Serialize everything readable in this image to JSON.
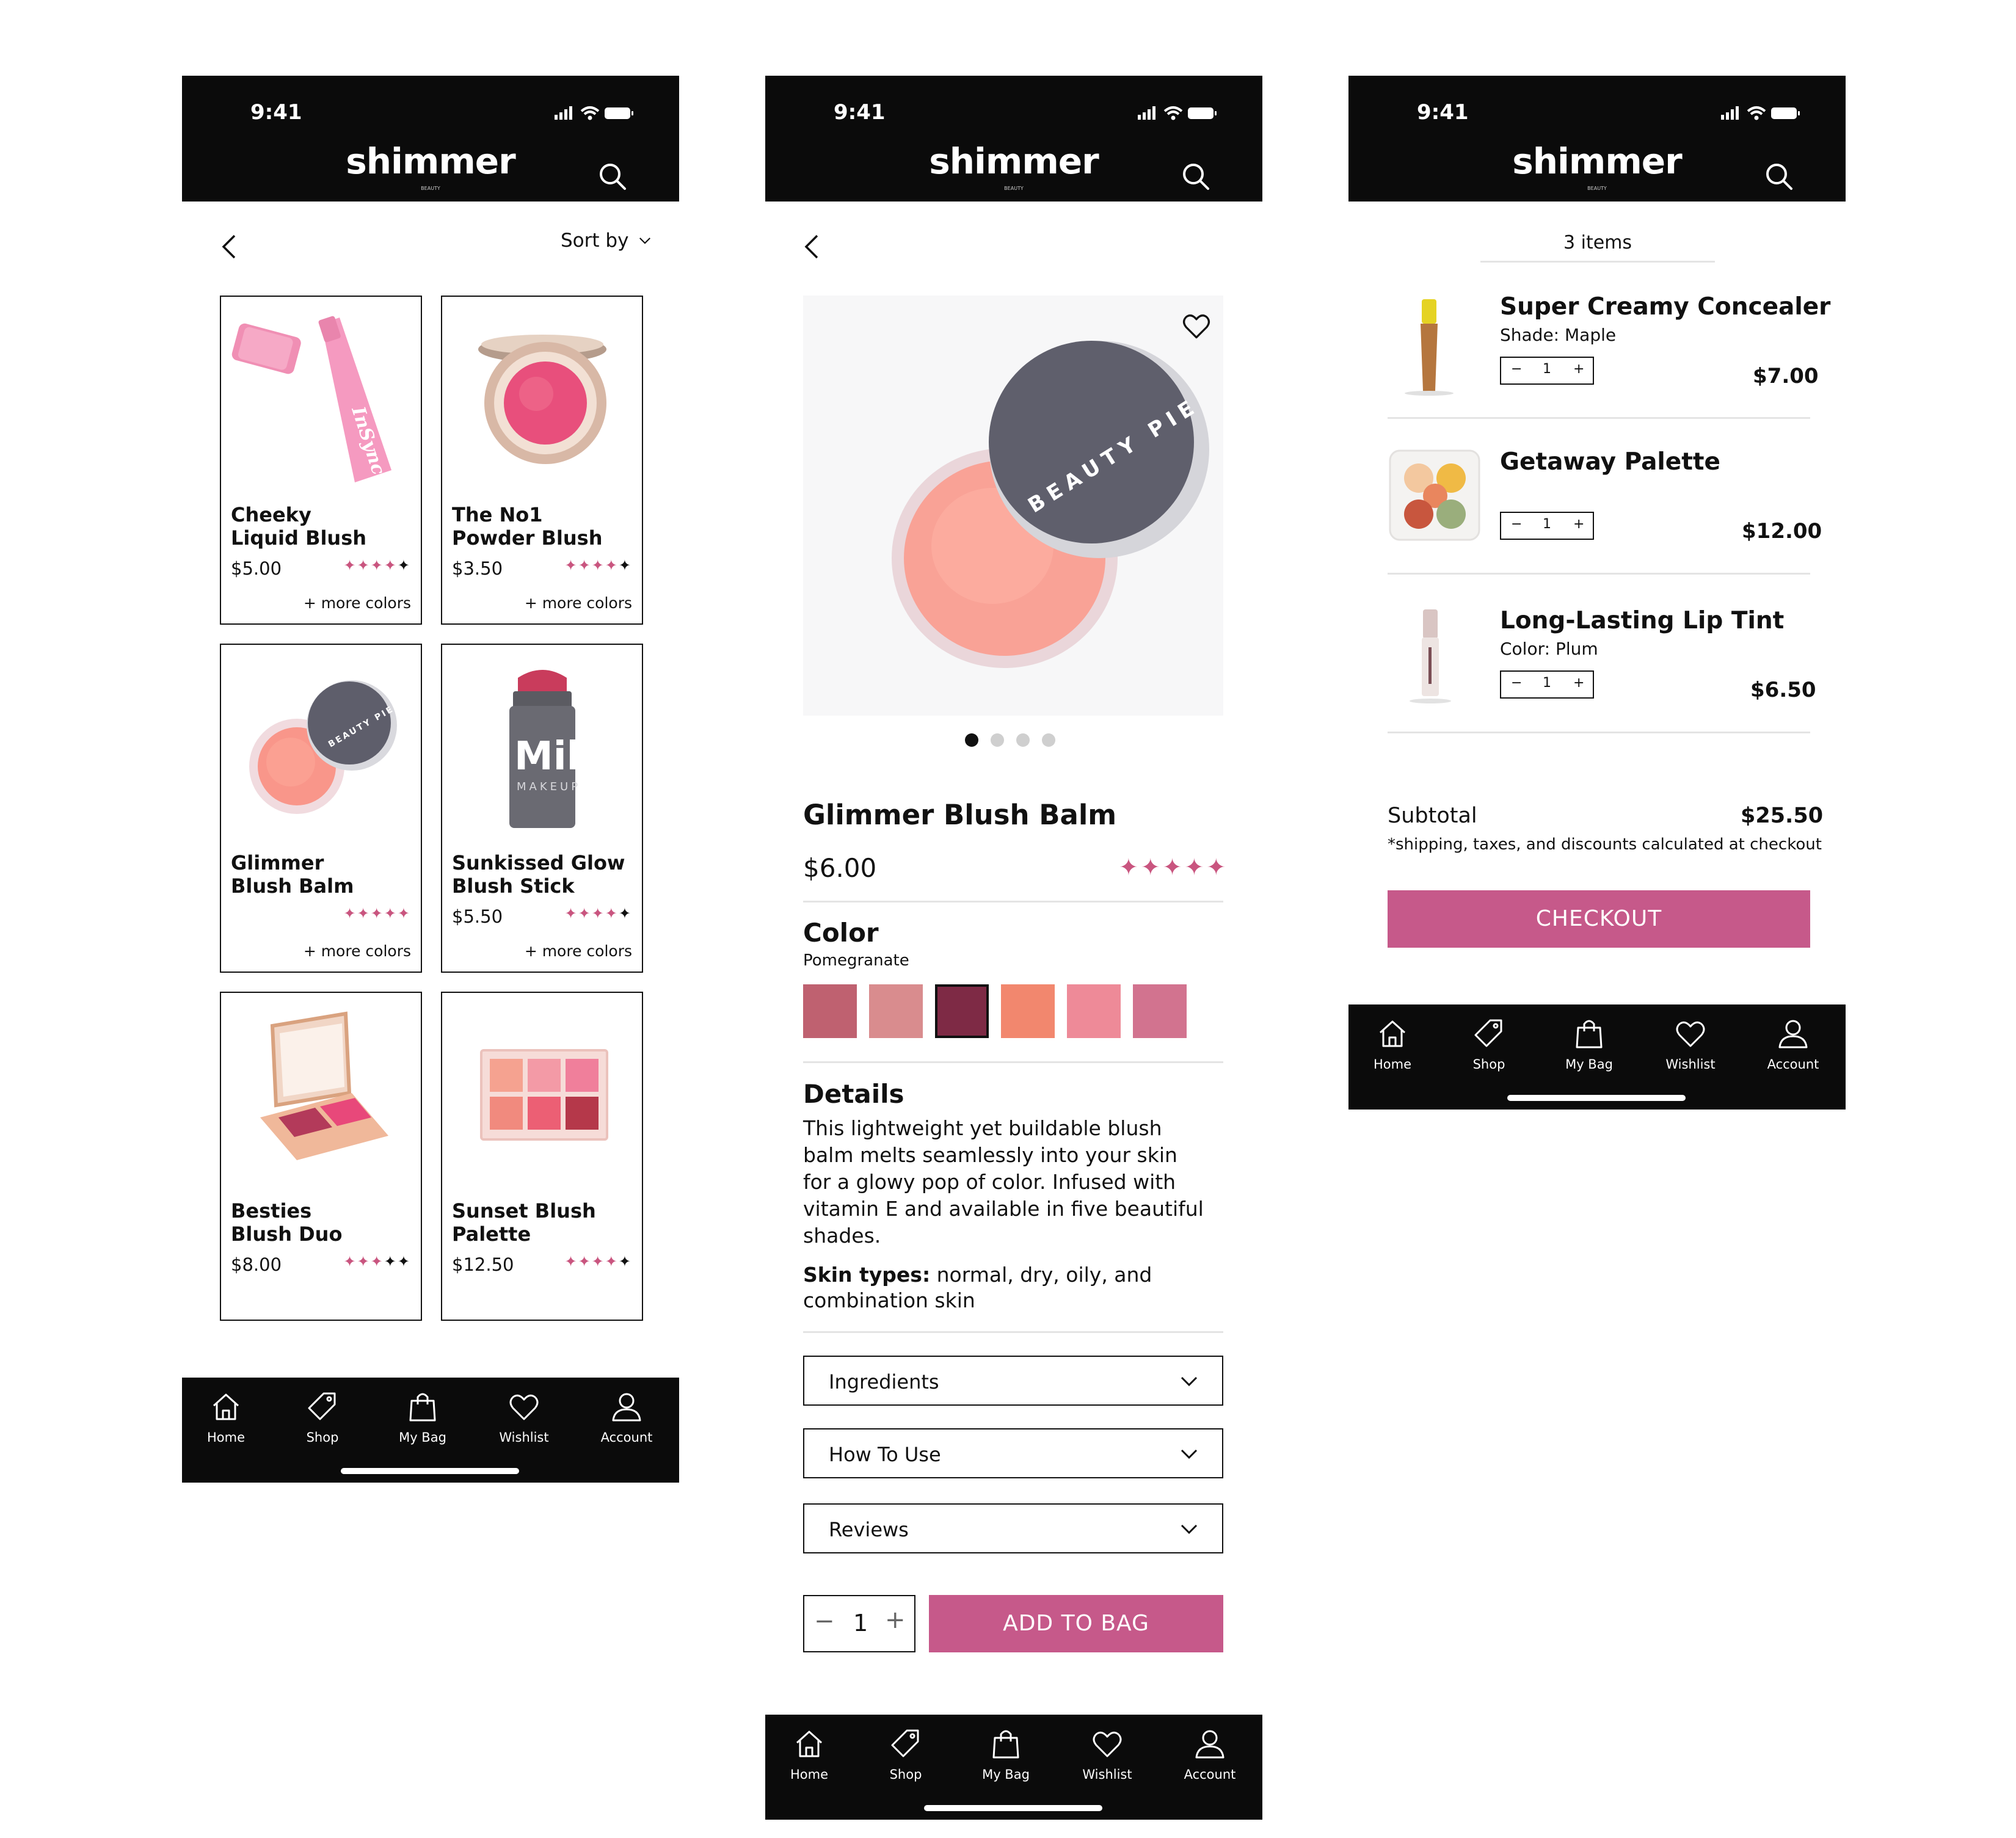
{
  "status_bar": {
    "time": "9:41"
  },
  "brand": {
    "logo": "shimmer",
    "logo_sub": "BEAUTY",
    "accent": "#c6598a",
    "star_color": "#c9557f",
    "header_bg": "#0b0b0b"
  },
  "nav": {
    "items": [
      {
        "label": "Home",
        "icon": "home-icon"
      },
      {
        "label": "Shop",
        "icon": "tag-icon"
      },
      {
        "label": "My Bag",
        "icon": "bag-icon"
      },
      {
        "label": "Wishlist",
        "icon": "heart-icon"
      },
      {
        "label": "Account",
        "icon": "user-icon"
      }
    ]
  },
  "listing": {
    "sort_label": "Sort by",
    "products": [
      {
        "name_line1": "Cheeky",
        "name_line2": "Liquid Blush",
        "price": "$5.00",
        "rating": 4.5,
        "more": "+ more colors"
      },
      {
        "name_line1": "The No1",
        "name_line2": "Powder Blush",
        "price": "$3.50",
        "rating": 4,
        "more": "+ more colors"
      },
      {
        "name_line1": "Glimmer",
        "name_line2": "Blush Balm",
        "price": "",
        "rating": 5,
        "more": "+ more colors"
      },
      {
        "name_line1": "Sunkissed Glow",
        "name_line2": "Blush Stick",
        "price": "$5.50",
        "rating": 4,
        "more": "+ more colors"
      },
      {
        "name_line1": "Besties",
        "name_line2": "Blush Duo",
        "price": "$8.00",
        "rating": 3.5,
        "more": ""
      },
      {
        "name_line1": "Sunset Blush",
        "name_line2": "Palette",
        "price": "$12.50",
        "rating": 4,
        "more": ""
      }
    ]
  },
  "detail": {
    "title": "Glimmer Blush Balm",
    "price": "$6.00",
    "rating": 5,
    "image_brand": "BEAUTY PIE",
    "carousel_pages": 4,
    "carousel_active": 1,
    "color_heading": "Color",
    "color_selected": "Pomegranate",
    "swatches": [
      "#bf6170",
      "#d98c8e",
      "#7e2a45",
      "#f2876e",
      "#ee8a98",
      "#d2738f"
    ],
    "swatch_selected_index": 2,
    "details_heading": "Details",
    "details_text": "This lightweight yet buildable blush balm melts seamlessly into your skin for a glowy pop of color. Infused with vitamin E and available in five beautiful shades.",
    "skin_types_label": "Skin types:",
    "skin_types_value": " normal, dry, oily, and combination skin",
    "accordions": [
      "Ingredients",
      "How To Use",
      "Reviews"
    ],
    "quantity": "1",
    "add_to_bag": "ADD TO BAG"
  },
  "bag": {
    "items_count": "3 items",
    "items": [
      {
        "name": "Super Creamy Concealer",
        "variant": "Shade: Maple",
        "qty": "1",
        "price": "$7.00"
      },
      {
        "name": "Getaway Palette",
        "variant": "",
        "qty": "1",
        "price": "$12.00"
      },
      {
        "name": "Long-Lasting Lip Tint",
        "variant": "Color: Plum",
        "qty": "1",
        "price": "$6.50"
      }
    ],
    "subtotal_label": "Subtotal",
    "subtotal_value": "$25.50",
    "note": "*shipping, taxes, and discounts calculated at checkout",
    "checkout": "CHECKOUT"
  }
}
